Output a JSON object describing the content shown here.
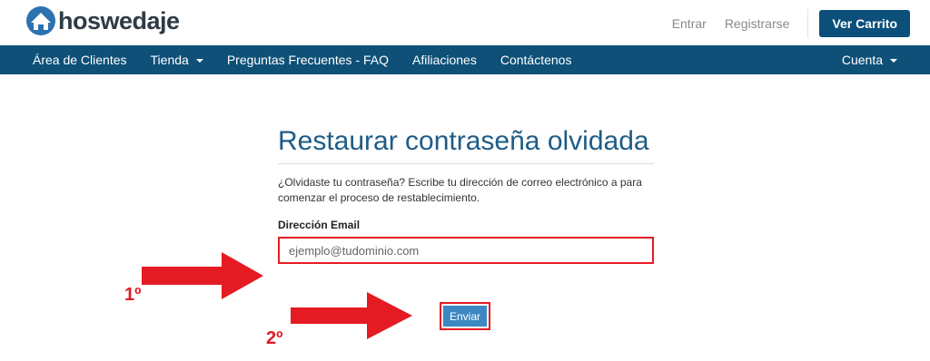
{
  "header": {
    "logo_text": "hoswedaje",
    "links": [
      "Entrar",
      "Registrarse"
    ],
    "cart_button": "Ver Carrito"
  },
  "nav": {
    "items": [
      {
        "label": "Área de Clientes",
        "has_dropdown": false
      },
      {
        "label": "Tienda",
        "has_dropdown": true
      },
      {
        "label": "Preguntas Frecuentes - FAQ",
        "has_dropdown": false
      },
      {
        "label": "Afiliaciones",
        "has_dropdown": false
      },
      {
        "label": "Contáctenos",
        "has_dropdown": false
      }
    ],
    "account": "Cuenta"
  },
  "main": {
    "title": "Restaurar contraseña olvidada",
    "description": "¿Olvidaste tu contraseña? Escribe tu dirección de correo electrónico a para comenzar el proceso de restablecimiento.",
    "email_label": "Dirección Email",
    "email_placeholder": "ejemplo@tudominio.com",
    "email_value": "",
    "submit_label": "Enviar"
  },
  "annotations": {
    "step1": "1º",
    "step2": "2º",
    "color": "#e41b23"
  },
  "colors": {
    "brand_dark": "#0e5078",
    "title_blue": "#1e5c86",
    "button_blue": "#3b88c3"
  }
}
